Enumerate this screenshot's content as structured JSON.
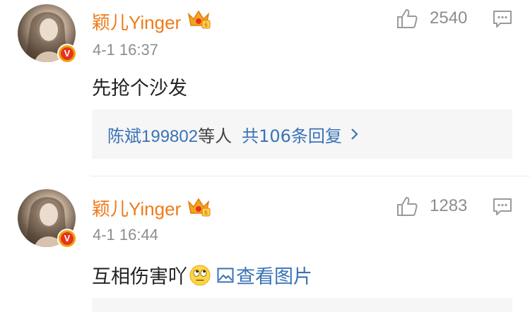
{
  "comments": [
    {
      "user": "颖儿Yinger",
      "time": "4-1 16:37",
      "text": "先抢个沙发",
      "likes": "2540",
      "reply_summary": {
        "names": "陈斌199802",
        "suffix": "等人",
        "total": "共106条回复"
      }
    },
    {
      "user": "颖儿Yinger",
      "time": "4-1 16:44",
      "text": "互相伤害吖",
      "emoji": "eye-roll-emoji",
      "image_link": "查看图片",
      "likes": "1283"
    }
  ],
  "icons": {
    "like": "thumbs-up-icon",
    "reply": "comment-bubble-icon",
    "verified": "verified-v-badge",
    "member": "crown-member-icon"
  },
  "colors": {
    "username": "#ef7b1a",
    "link": "#3a72b8",
    "meta": "#8d8d8d",
    "reply_bg": "#f6f6f6"
  }
}
